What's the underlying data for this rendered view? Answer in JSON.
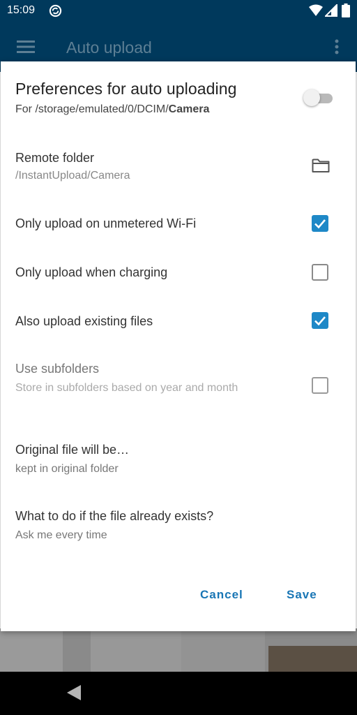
{
  "status_bar": {
    "time": "15:09",
    "icons": [
      "sync-notification-icon",
      "wifi-icon",
      "signal-icon",
      "battery-icon"
    ]
  },
  "app_bar": {
    "title": "Auto upload",
    "icons": [
      "hamburger-menu-icon",
      "more-vert-icon"
    ]
  },
  "dialog": {
    "title": "Preferences for auto uploading",
    "path_prefix": "For /storage/emulated/0/DCIM/",
    "path_folder": "Camera",
    "enabled": false,
    "remote_folder": {
      "label": "Remote folder",
      "value": "/InstantUpload/Camera",
      "icon": "folder-icon"
    },
    "options": [
      {
        "label": "Only upload on unmetered Wi-Fi",
        "checked": true
      },
      {
        "label": "Only upload when charging",
        "checked": false
      },
      {
        "label": "Also upload existing files",
        "checked": true
      },
      {
        "label": "Use subfolders",
        "sub": "Store in subfolders based on year and month",
        "checked": false,
        "disabled": true
      }
    ],
    "original_file": {
      "label": "Original file will be…",
      "value": "kept in original folder"
    },
    "file_exists": {
      "label": "What to do if the file already exists?",
      "value": "Ask me every time"
    },
    "buttons": {
      "cancel": "Cancel",
      "save": "Save"
    }
  },
  "colors": {
    "app_bar": "#00395c",
    "accent": "#1e88c7",
    "button_text": "#1976b5"
  }
}
